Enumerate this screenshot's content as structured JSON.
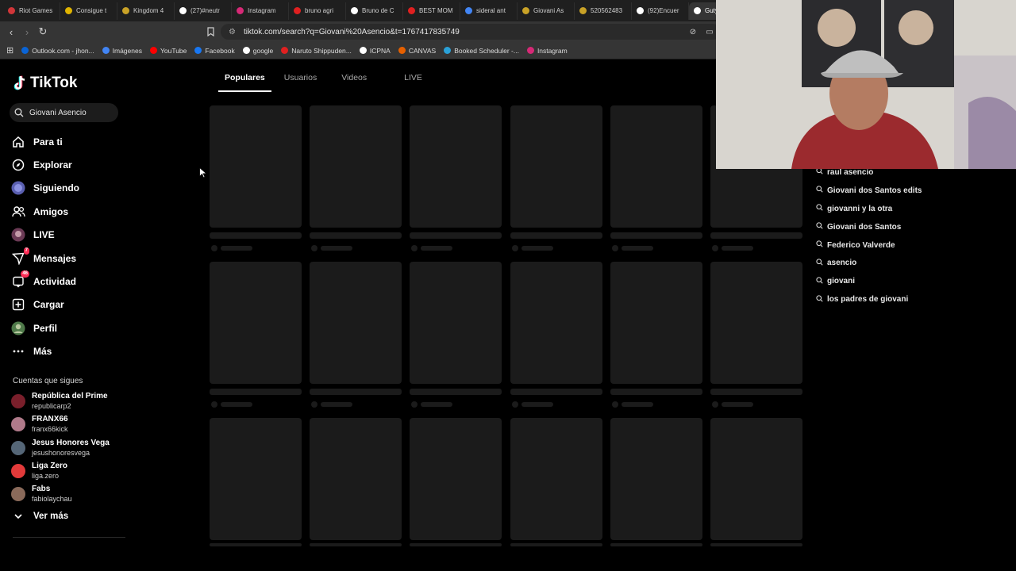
{
  "browser": {
    "tabs": [
      {
        "label": "Riot Games",
        "color": "#d13639"
      },
      {
        "label": "Consigue t",
        "color": "#e0b400"
      },
      {
        "label": "Kingdom 4",
        "color": "#c9a227"
      },
      {
        "label": "(27)#neutr",
        "color": "#ffffff"
      },
      {
        "label": "Instagram",
        "color": "#d62976"
      },
      {
        "label": "bruno agri",
        "color": "#e02020"
      },
      {
        "label": "Bruno de C",
        "color": "#ffffff"
      },
      {
        "label": "BEST MOM",
        "color": "#e02020"
      },
      {
        "label": "sideral ant",
        "color": "#4285f4"
      },
      {
        "label": "Giovani As",
        "color": "#c9a227"
      },
      {
        "label": "520562483",
        "color": "#c9a227"
      },
      {
        "label": "(92)Encuer",
        "color": "#ffffff"
      },
      {
        "label": "Guty",
        "color": "#ffffff"
      }
    ],
    "url": "tiktok.com/search?q=Giovani%20Asencio&t=1767417835749",
    "bookmarks": [
      {
        "label": "Outlook.com - jhon...",
        "color": "#0a64d6"
      },
      {
        "label": "Imágenes",
        "color": "#4285f4"
      },
      {
        "label": "YouTube",
        "color": "#ff0000"
      },
      {
        "label": "Facebook",
        "color": "#1877f2"
      },
      {
        "label": "google",
        "color": "#ffffff"
      },
      {
        "label": "Naruto Shippuden...",
        "color": "#e02020"
      },
      {
        "label": "ICPNA",
        "color": "#ffffff"
      },
      {
        "label": "CANVAS",
        "color": "#e66000"
      },
      {
        "label": "Booked Scheduler -...",
        "color": "#2aa1d8"
      },
      {
        "label": "Instagram",
        "color": "#d62976"
      }
    ]
  },
  "tiktok": {
    "logo": "TikTok",
    "search_value": "Giovani Asencio",
    "nav": [
      {
        "label": "Para ti",
        "icon": "home-icon"
      },
      {
        "label": "Explorar",
        "icon": "compass-icon"
      },
      {
        "label": "Siguiendo",
        "icon": "avatar-icon"
      },
      {
        "label": "Amigos",
        "icon": "friends-icon"
      },
      {
        "label": "LIVE",
        "icon": "live-icon"
      },
      {
        "label": "Mensajes",
        "icon": "messages-icon",
        "badge": "7"
      },
      {
        "label": "Actividad",
        "icon": "activity-icon",
        "badge": "46"
      },
      {
        "label": "Cargar",
        "icon": "upload-icon"
      },
      {
        "label": "Perfil",
        "icon": "profile-icon"
      },
      {
        "label": "Más",
        "icon": "more-icon"
      }
    ],
    "following_title": "Cuentas que sigues",
    "accounts": [
      {
        "name": "República del Prime",
        "handle": "republicarp2",
        "color": "#7a1f2b"
      },
      {
        "name": "FRANX66",
        "handle": "franx66kick",
        "color": "#b07a8a"
      },
      {
        "name": "Jesus Honores Vega",
        "handle": "jesushonoresvega",
        "color": "#556677"
      },
      {
        "name": "Liga Zero",
        "handle": "liga.zero",
        "color": "#e23a3a"
      },
      {
        "name": "Fabs",
        "handle": "fabiolaychau",
        "color": "#8a6a5a"
      }
    ],
    "ver_mas": "Ver más",
    "tabs": [
      "Populares",
      "Usuarios",
      "Videos",
      "LIVE"
    ],
    "active_tab": "Populares",
    "suggestions": [
      "raul asencio",
      "Giovani dos Santos edits",
      "giovanni y la otra",
      "Giovani dos Santos",
      "Federico Valverde",
      "asencio",
      "giovani",
      "los padres de giovani"
    ]
  }
}
